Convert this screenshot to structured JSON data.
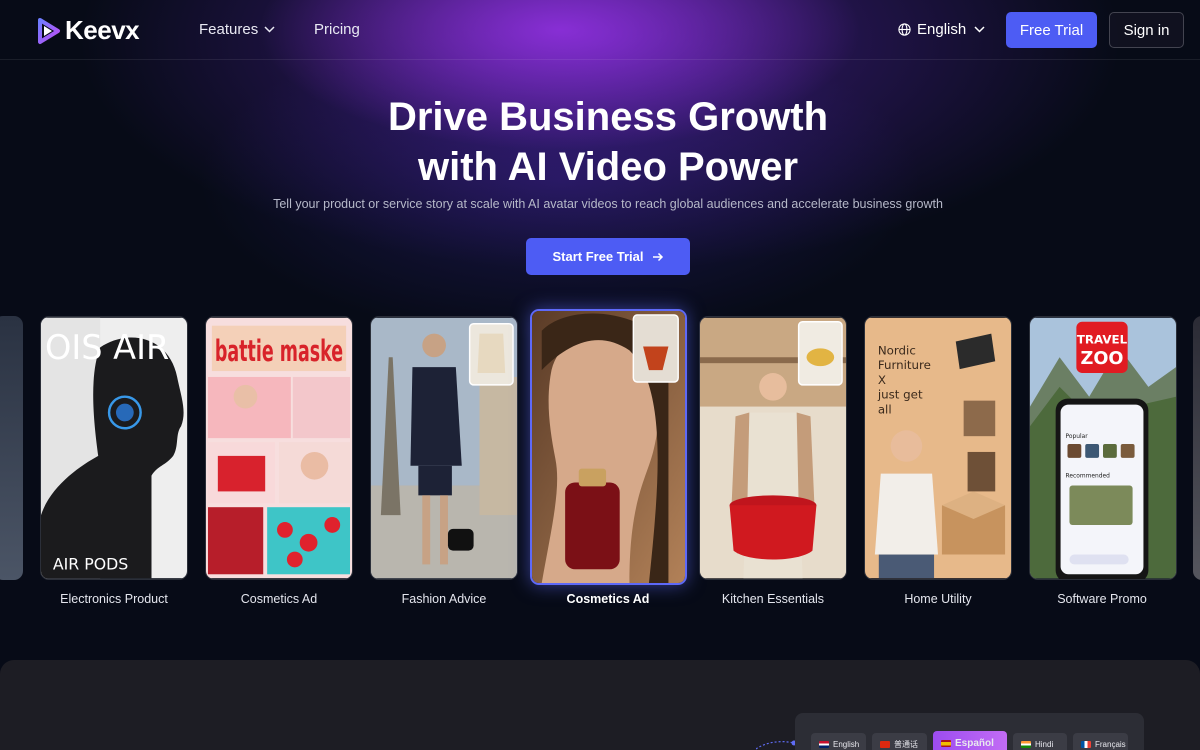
{
  "brand": {
    "name": "Keevx"
  },
  "nav": {
    "features": "Features",
    "pricing": "Pricing",
    "language": "English",
    "free_trial": "Free Trial",
    "sign_in": "Sign in"
  },
  "hero": {
    "title_line1": "Drive Business Growth",
    "title_line2": "with AI Video Power",
    "subtitle": "Tell your product or service story at scale with AI avatar videos to reach global audiences and accelerate business growth",
    "cta": "Start Free Trial"
  },
  "cards": [
    {
      "label": "Electronics Product",
      "overlay_top": "OIS AIR",
      "overlay_bottom": "AIR PODS"
    },
    {
      "label": "Cosmetics Ad",
      "overlay_top": "battie maske"
    },
    {
      "label": "Fashion Advice"
    },
    {
      "label": "Cosmetics Ad",
      "active": true
    },
    {
      "label": "Kitchen Essentials"
    },
    {
      "label": "Home Utility",
      "overlay_lines": [
        "Nordic",
        "Furniture",
        "X",
        "just get",
        "all"
      ]
    },
    {
      "label": "Software Promo",
      "badge_top": "TRAVEL",
      "badge_bottom": "ZOO",
      "app_sections": [
        "Popular",
        "Recommended"
      ]
    }
  ],
  "languages": [
    {
      "label": "English"
    },
    {
      "label": "普通话"
    },
    {
      "label": "Español",
      "selected": true
    },
    {
      "label": "Hindi"
    },
    {
      "label": "Français"
    }
  ],
  "colors": {
    "accent": "#4d5cf4",
    "background": "#070b17",
    "glow": "#8e3be0",
    "selected_lang": "#a655f1"
  },
  "icons": [
    "keevx-logo-icon",
    "chevron-down-icon",
    "globe-icon",
    "arrow-right-icon"
  ]
}
